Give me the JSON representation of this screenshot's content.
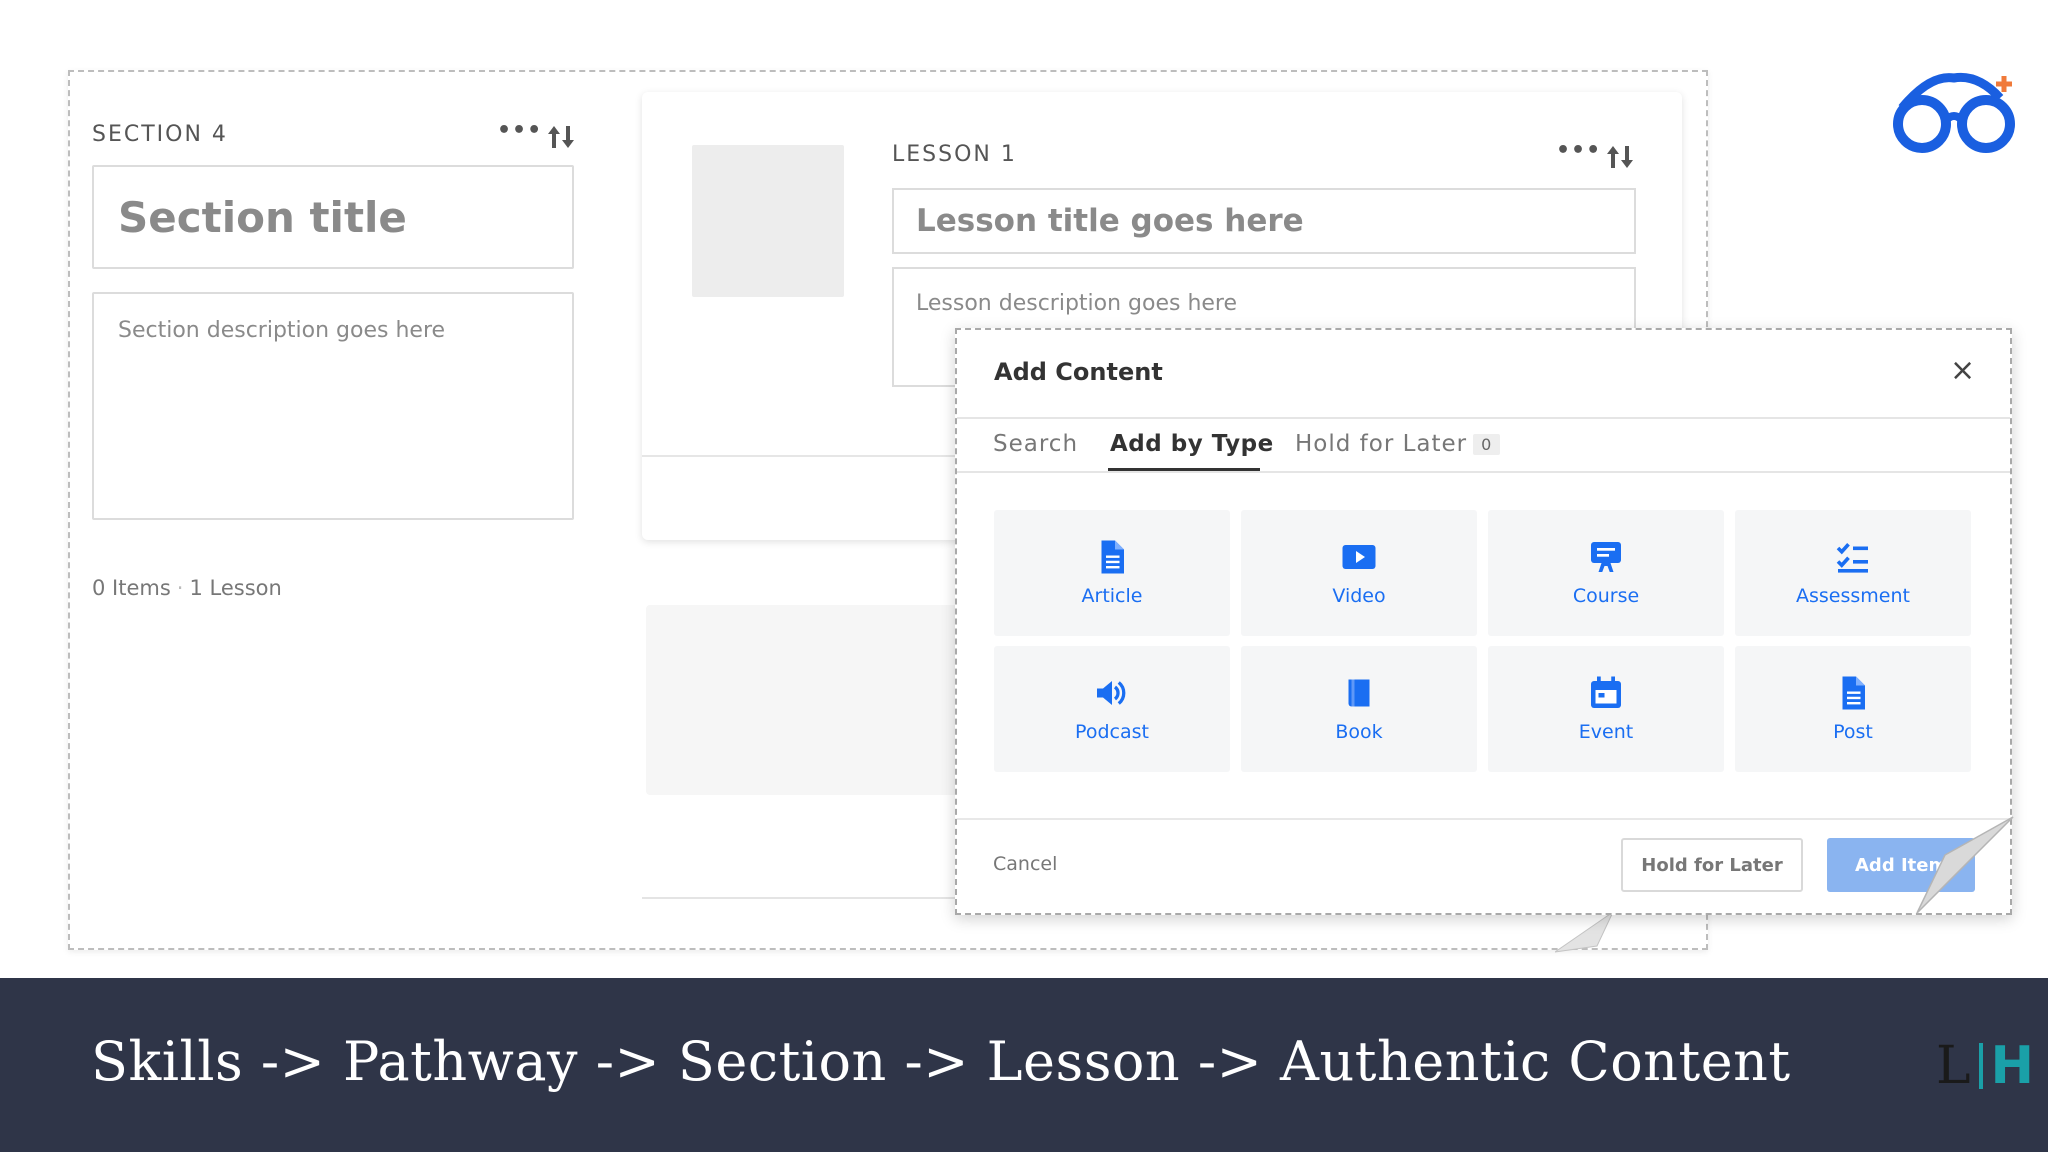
{
  "section": {
    "label": "SECTION 4",
    "title_placeholder": "Section title",
    "description_placeholder": "Section description goes here",
    "items_count": "0 Items",
    "lessons_count": "1 Lesson",
    "more_icon": "•••"
  },
  "lesson": {
    "label": "LESSON 1",
    "title_placeholder": "Lesson title goes here",
    "description_placeholder": "Lesson description goes here",
    "more_icon": "•••"
  },
  "modal": {
    "title": "Add Content",
    "close_icon": "×",
    "tabs": [
      {
        "label": "Search"
      },
      {
        "label": "Add by Type"
      },
      {
        "label": "Hold for Later",
        "badge": "0"
      }
    ],
    "content_types": [
      {
        "label": "Article",
        "icon": "article-icon"
      },
      {
        "label": "Video",
        "icon": "video-icon"
      },
      {
        "label": "Course",
        "icon": "course-icon"
      },
      {
        "label": "Assessment",
        "icon": "assessment-icon"
      },
      {
        "label": "Podcast",
        "icon": "podcast-icon"
      },
      {
        "label": "Book",
        "icon": "book-icon"
      },
      {
        "label": "Event",
        "icon": "event-icon"
      },
      {
        "label": "Post",
        "icon": "post-icon"
      }
    ],
    "cancel_label": "Cancel",
    "hold_label": "Hold for Later",
    "add_label": "Add Items"
  },
  "banner": {
    "text": "Skills -> Pathway -> Section -> Lesson -> Authentic Content",
    "logo_left": "L",
    "logo_right": "H"
  },
  "colors": {
    "accent": "#1a6ef2",
    "banner_bg": "#2f3548",
    "logo_teal": "#1aa0a8",
    "glasses_blue": "#1a5fe0",
    "glasses_orange": "#f07a3a"
  }
}
